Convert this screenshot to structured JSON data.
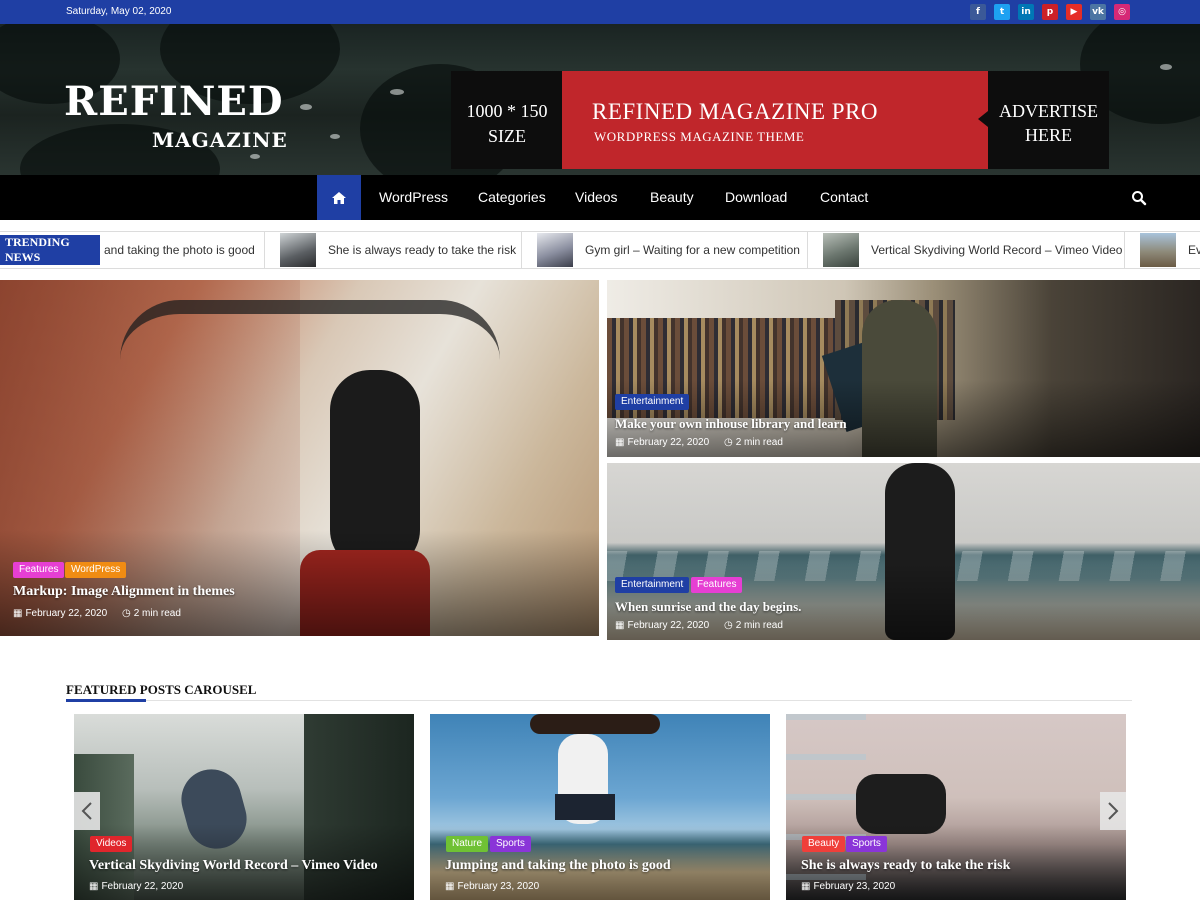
{
  "topbar": {
    "date": "Saturday, May 02, 2020",
    "socials": [
      {
        "icon": "facebook-icon",
        "glyph": "f",
        "color": "#3b5998"
      },
      {
        "icon": "twitter-icon",
        "glyph": "t",
        "color": "#1da1f2"
      },
      {
        "icon": "linkedin-icon",
        "glyph": "in",
        "color": "#0077b5"
      },
      {
        "icon": "pinterest-icon",
        "glyph": "p",
        "color": "#cb2027"
      },
      {
        "icon": "youtube-icon",
        "glyph": "▶",
        "color": "#e52d27"
      },
      {
        "icon": "vk-icon",
        "glyph": "vk",
        "color": "#4c75a3"
      },
      {
        "icon": "instagram-icon",
        "glyph": "◎",
        "color": "#d62976"
      }
    ]
  },
  "header": {
    "logo_line1": "REFINED",
    "logo_line2": "MAGAZINE",
    "ad": {
      "size_line1": "1000 * 150",
      "size_line2": "SIZE",
      "pro_line1": "REFINED MAGAZINE PRO",
      "pro_line2": "WORDPRESS MAGAZINE THEME",
      "advertise_line1": "ADVERTISE",
      "advertise_line2": "HERE"
    }
  },
  "nav": {
    "items": [
      "WordPress",
      "Categories",
      "Videos",
      "Beauty",
      "Download",
      "Contact"
    ]
  },
  "trending": {
    "label": "TRENDING NEWS",
    "items": [
      "and taking the photo is good",
      "She is always ready to take the risk",
      "Gym girl – Waiting for a new competition",
      "Vertical Skydiving World Record – Vimeo Video",
      "Ev"
    ]
  },
  "featured": [
    {
      "categories": [
        {
          "label": "Features",
          "color": "#e63fd3"
        },
        {
          "label": "WordPress",
          "color": "#f08c13"
        }
      ],
      "title": "Markup: Image Alignment in themes",
      "date": "February 22, 2020",
      "read": "2 min read"
    },
    {
      "categories": [
        {
          "label": "Entertainment",
          "color": "#1f3fa4"
        }
      ],
      "title": "Make your own inhouse library and learn",
      "date": "February 22, 2020",
      "read": "2 min read"
    },
    {
      "categories": [
        {
          "label": "Entertainment",
          "color": "#1f3fa4"
        },
        {
          "label": "Features",
          "color": "#e63fd3"
        }
      ],
      "title": "When sunrise and the day begins.",
      "date": "February 22, 2020",
      "read": "2 min read"
    }
  ],
  "carousel": {
    "title": "FEATURED POSTS CAROUSEL",
    "items": [
      {
        "categories": [
          {
            "label": "Videos",
            "color": "#e0262c"
          }
        ],
        "title": "Vertical Skydiving World Record – Vimeo Video",
        "date": "February 22, 2020"
      },
      {
        "categories": [
          {
            "label": "Nature",
            "color": "#6fc134"
          },
          {
            "label": "Sports",
            "color": "#8a35d8"
          }
        ],
        "title": "Jumping and taking the photo is good",
        "date": "February 23, 2020"
      },
      {
        "categories": [
          {
            "label": "Beauty",
            "color": "#ef3f3a"
          },
          {
            "label": "Sports",
            "color": "#8a35d8"
          }
        ],
        "title": "She is always ready to take the risk",
        "date": "February 23, 2020"
      }
    ]
  }
}
